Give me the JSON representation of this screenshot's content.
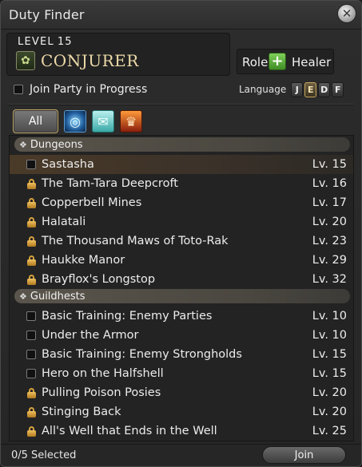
{
  "window": {
    "title": "Duty Finder"
  },
  "job": {
    "level_label": "LEVEL",
    "level": "15",
    "name": "CONJURER"
  },
  "role": {
    "label": "Role:",
    "name": "Healer"
  },
  "options": {
    "join_in_progress_label": "Join Party in Progress",
    "join_in_progress_checked": false
  },
  "language": {
    "label": "Language",
    "options": [
      "J",
      "E",
      "D",
      "F"
    ],
    "selected": "E"
  },
  "filters": {
    "all_label": "All",
    "icons": [
      "dungeon-filter-icon",
      "guildhest-filter-icon",
      "trial-filter-icon"
    ]
  },
  "sections": [
    {
      "title": "Dungeons"
    },
    {
      "title": "Guildhests"
    }
  ],
  "dungeons": [
    {
      "name": "Sastasha",
      "level": "Lv. 15",
      "status": "checkbox",
      "selected": true
    },
    {
      "name": "The Tam-Tara Deepcroft",
      "level": "Lv. 16",
      "status": "locked"
    },
    {
      "name": "Copperbell Mines",
      "level": "Lv. 17",
      "status": "locked"
    },
    {
      "name": "Halatali",
      "level": "Lv. 20",
      "status": "locked"
    },
    {
      "name": "The Thousand Maws of Toto-Rak",
      "level": "Lv. 23",
      "status": "locked"
    },
    {
      "name": "Haukke Manor",
      "level": "Lv. 29",
      "status": "locked"
    },
    {
      "name": "Brayflox's Longstop",
      "level": "Lv. 32",
      "status": "locked"
    }
  ],
  "guildhests": [
    {
      "name": "Basic Training: Enemy Parties",
      "level": "Lv. 10",
      "status": "checkbox"
    },
    {
      "name": "Under the Armor",
      "level": "Lv. 10",
      "status": "checkbox"
    },
    {
      "name": "Basic Training: Enemy Strongholds",
      "level": "Lv. 15",
      "status": "checkbox"
    },
    {
      "name": "Hero on the Halfshell",
      "level": "Lv. 15",
      "status": "checkbox"
    },
    {
      "name": "Pulling Poison Posies",
      "level": "Lv. 20",
      "status": "locked"
    },
    {
      "name": "Stinging Back",
      "level": "Lv. 20",
      "status": "locked"
    },
    {
      "name": "All's Well that Ends in the Well",
      "level": "Lv. 25",
      "status": "locked"
    }
  ],
  "footer": {
    "selected_count": "0/5 Selected",
    "join_label": "Join"
  },
  "colors": {
    "lock": "#d4a13d",
    "job_name": "#ecd9a8",
    "accent_border": "#c2a868"
  }
}
